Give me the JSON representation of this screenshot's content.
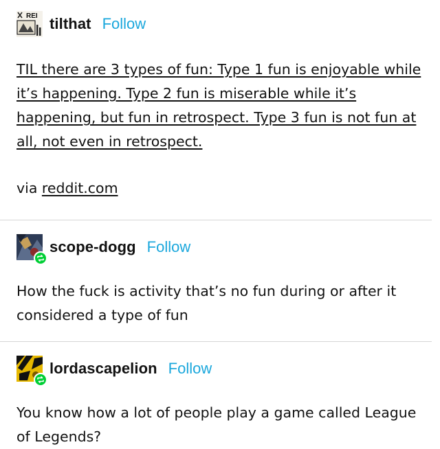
{
  "posts": [
    {
      "username": "tilthat",
      "follow_label": "Follow",
      "avatar_text": "REI",
      "body": "TIL there are 3 types of fun: Type 1 fun is enjoyable while it’s happening. Type 2 fun is miserable while it’s happening, but fun in retrospect. Type 3 fun is not fun at all, not even in retrospect.",
      "via_prefix": "via ",
      "via_link": "reddit.com"
    },
    {
      "username": "scope-dogg",
      "follow_label": "Follow",
      "body": "How the fuck is activity that’s no fun during or after it considered a type of fun"
    },
    {
      "username": "lordascapelion",
      "follow_label": "Follow",
      "body": "You know how a lot of people play a game called League of Legends?"
    }
  ],
  "colors": {
    "follow": "#1aa7dc",
    "reblog_badge": "#00cf35",
    "divider": "#d6d6d6"
  },
  "icons": {
    "reblog": "reblog-icon"
  }
}
